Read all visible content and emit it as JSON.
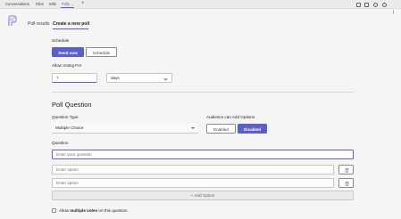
{
  "topbar": {
    "tabs": [
      {
        "label": "Conversations"
      },
      {
        "label": "Files"
      },
      {
        "label": "Wiki"
      },
      {
        "label": "Polly"
      }
    ],
    "active_caret": "⌄",
    "add_tab": "+"
  },
  "subnav": {
    "results": "Poll results",
    "create": "Create a new poll"
  },
  "schedule": {
    "label": "Schedule",
    "send_now": "Send now",
    "schedule": "Schedule"
  },
  "voting": {
    "label": "Allow Voting For",
    "value": "7",
    "unit": "days"
  },
  "poll_question": {
    "title": "Poll Question",
    "type_label": "Question Type",
    "type_value": "Multiple Choice",
    "audience_label": "Audience can Add Options",
    "enabled": "Enabled",
    "disabled": "Disabled",
    "question_label": "Question",
    "question_placeholder": "Enter your question",
    "options": [
      {
        "placeholder": "Enter option"
      },
      {
        "placeholder": "Enter option"
      }
    ],
    "add_option": "+ Add Option"
  },
  "footer": {
    "allow_prefix": "Allow ",
    "allow_bold": "multiple votes",
    "allow_suffix": " on this question"
  },
  "colors": {
    "accent": "#5b5fc7",
    "background": "#f5f5f5"
  }
}
